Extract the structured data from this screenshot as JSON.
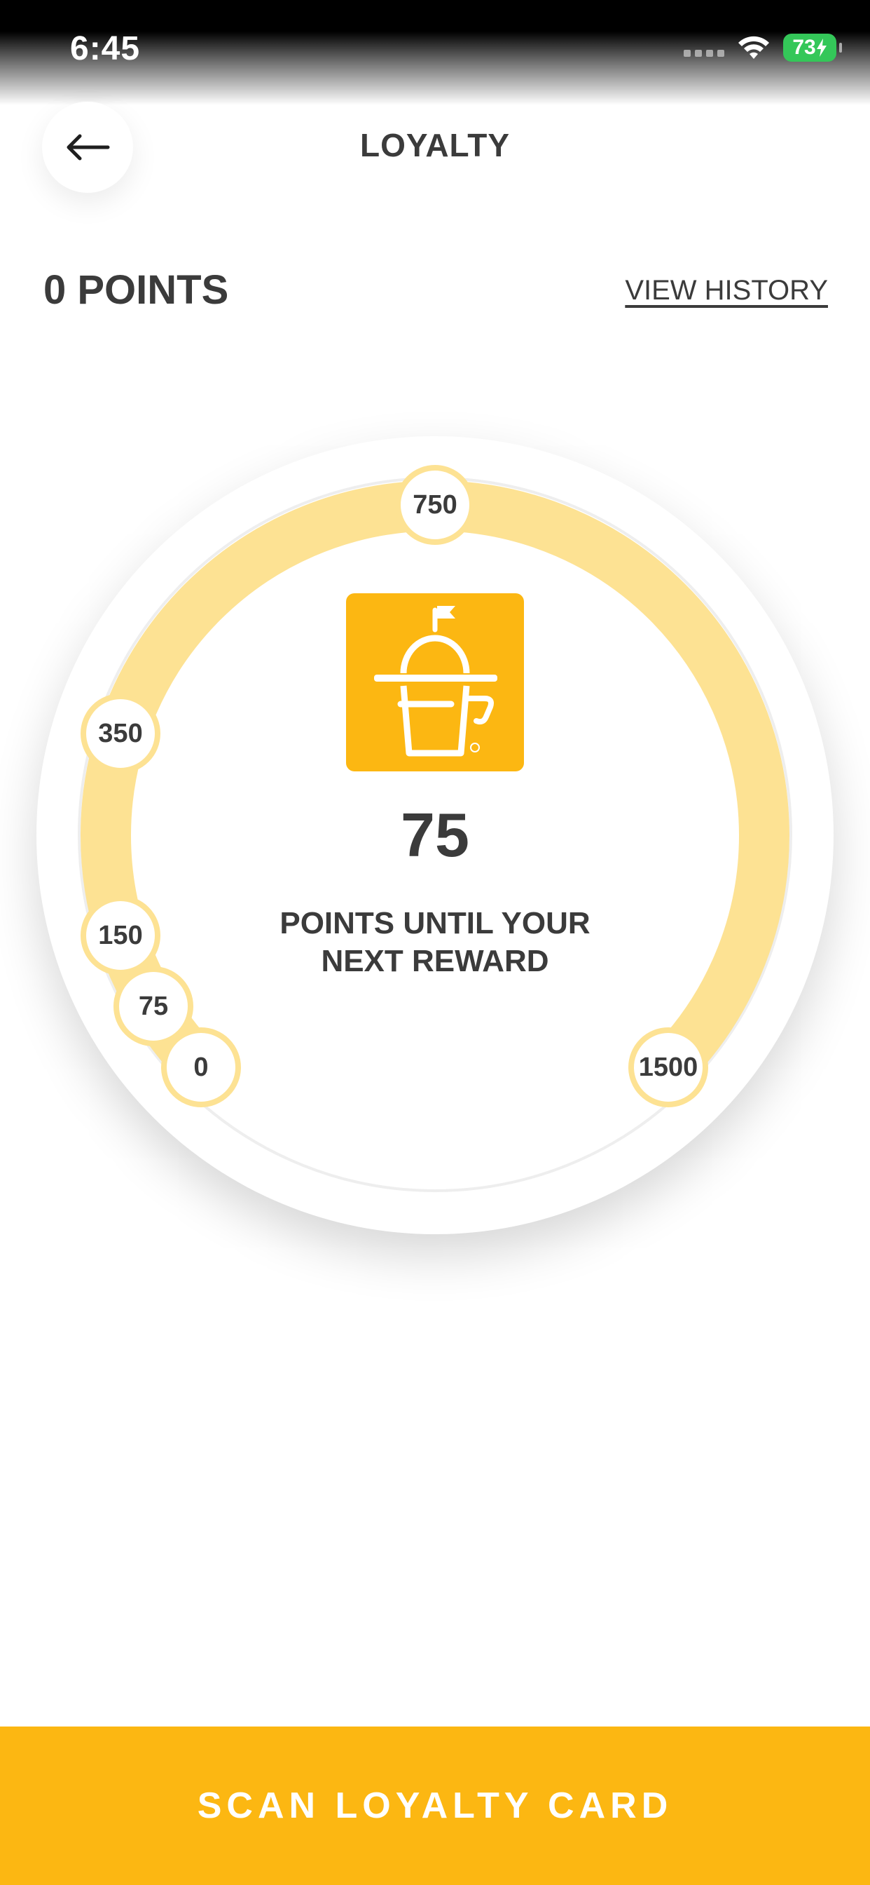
{
  "status_bar": {
    "time": "6:45",
    "battery_level": "73"
  },
  "header": {
    "title": "LOYALTY",
    "back_icon": "arrow-left-icon"
  },
  "summary": {
    "points_label": "0 POINTS",
    "view_history_label": "VIEW HISTORY"
  },
  "dial": {
    "milestones": [
      "750",
      "350",
      "150",
      "75",
      "0",
      "1500"
    ],
    "points_remaining": "75",
    "caption_line1": "POINTS UNTIL YOUR",
    "caption_line2": "NEXT REWARD",
    "icon": "bucket-logo-icon"
  },
  "footer": {
    "scan_button_label": "SCAN LOYALTY CARD"
  },
  "colors": {
    "accent": "#fcb712",
    "track": "#fde293",
    "text": "#3b3b3b",
    "battery": "#34c759"
  }
}
